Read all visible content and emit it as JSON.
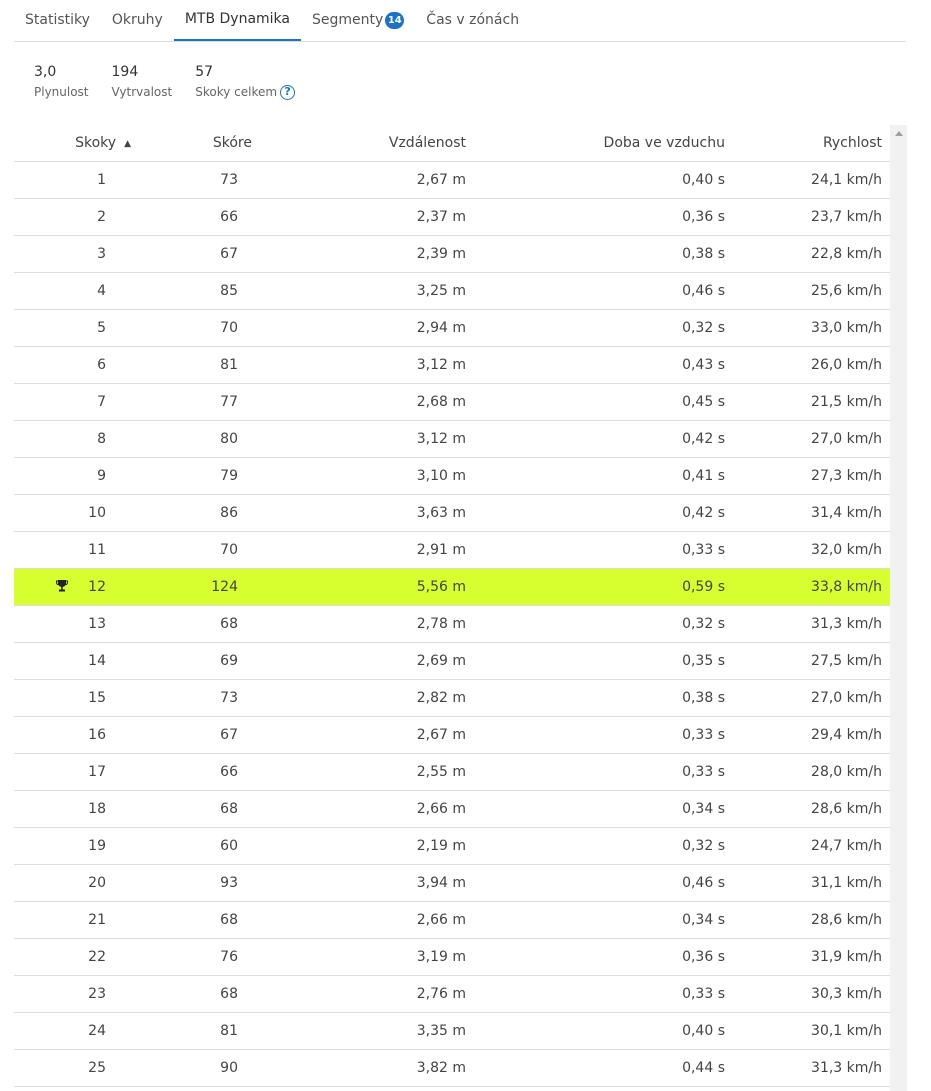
{
  "tabs": [
    {
      "label": "Statistiky"
    },
    {
      "label": "Okruhy"
    },
    {
      "label": "MTB Dynamika",
      "active": true
    },
    {
      "label": "Segmenty",
      "badge": "14"
    },
    {
      "label": "Čas v zónách"
    }
  ],
  "stats": [
    {
      "value": "3,0",
      "label": "Plynulost"
    },
    {
      "value": "194",
      "label": "Vytrvalost"
    },
    {
      "value": "57",
      "label": "Skoky celkem"
    }
  ],
  "table": {
    "headers": [
      "Skoky",
      "Skóre",
      "Vzdálenost",
      "Doba ve vzduchu",
      "Rychlost"
    ],
    "sort": {
      "column": "Skoky",
      "direction": "ascending"
    },
    "highlight_color": "#d7ff2f",
    "rows": [
      [
        "1",
        "73",
        "2,67 m",
        "0,40 s",
        "24,1 km/h"
      ],
      [
        "2",
        "66",
        "2,37 m",
        "0,36 s",
        "23,7 km/h"
      ],
      [
        "3",
        "67",
        "2,39 m",
        "0,38 s",
        "22,8 km/h"
      ],
      [
        "4",
        "85",
        "3,25 m",
        "0,46 s",
        "25,6 km/h"
      ],
      [
        "5",
        "70",
        "2,94 m",
        "0,32 s",
        "33,0 km/h"
      ],
      [
        "6",
        "81",
        "3,12 m",
        "0,43 s",
        "26,0 km/h"
      ],
      [
        "7",
        "77",
        "2,68 m",
        "0,45 s",
        "21,5 km/h"
      ],
      [
        "8",
        "80",
        "3,12 m",
        "0,42 s",
        "27,0 km/h"
      ],
      [
        "9",
        "79",
        "3,10 m",
        "0,41 s",
        "27,3 km/h"
      ],
      [
        "10",
        "86",
        "3,63 m",
        "0,42 s",
        "31,4 km/h"
      ],
      [
        "11",
        "70",
        "2,91 m",
        "0,33 s",
        "32,0 km/h"
      ],
      [
        "12",
        "124",
        "5,56 m",
        "0,59 s",
        "33,8 km/h"
      ],
      [
        "13",
        "68",
        "2,78 m",
        "0,32 s",
        "31,3 km/h"
      ],
      [
        "14",
        "69",
        "2,69 m",
        "0,35 s",
        "27,5 km/h"
      ],
      [
        "15",
        "73",
        "2,82 m",
        "0,38 s",
        "27,0 km/h"
      ],
      [
        "16",
        "67",
        "2,67 m",
        "0,33 s",
        "29,4 km/h"
      ],
      [
        "17",
        "66",
        "2,55 m",
        "0,33 s",
        "28,0 km/h"
      ],
      [
        "18",
        "68",
        "2,66 m",
        "0,34 s",
        "28,6 km/h"
      ],
      [
        "19",
        "60",
        "2,19 m",
        "0,32 s",
        "24,7 km/h"
      ],
      [
        "20",
        "93",
        "3,94 m",
        "0,46 s",
        "31,1 km/h"
      ],
      [
        "21",
        "68",
        "2,66 m",
        "0,34 s",
        "28,6 km/h"
      ],
      [
        "22",
        "76",
        "3,19 m",
        "0,36 s",
        "31,9 km/h"
      ],
      [
        "23",
        "68",
        "2,76 m",
        "0,33 s",
        "30,3 km/h"
      ],
      [
        "24",
        "81",
        "3,35 m",
        "0,40 s",
        "30,1 km/h"
      ],
      [
        "25",
        "90",
        "3,82 m",
        "0,44 s",
        "31,3 km/h"
      ]
    ],
    "best_row": "12",
    "best_icon": "trophy-icon"
  }
}
